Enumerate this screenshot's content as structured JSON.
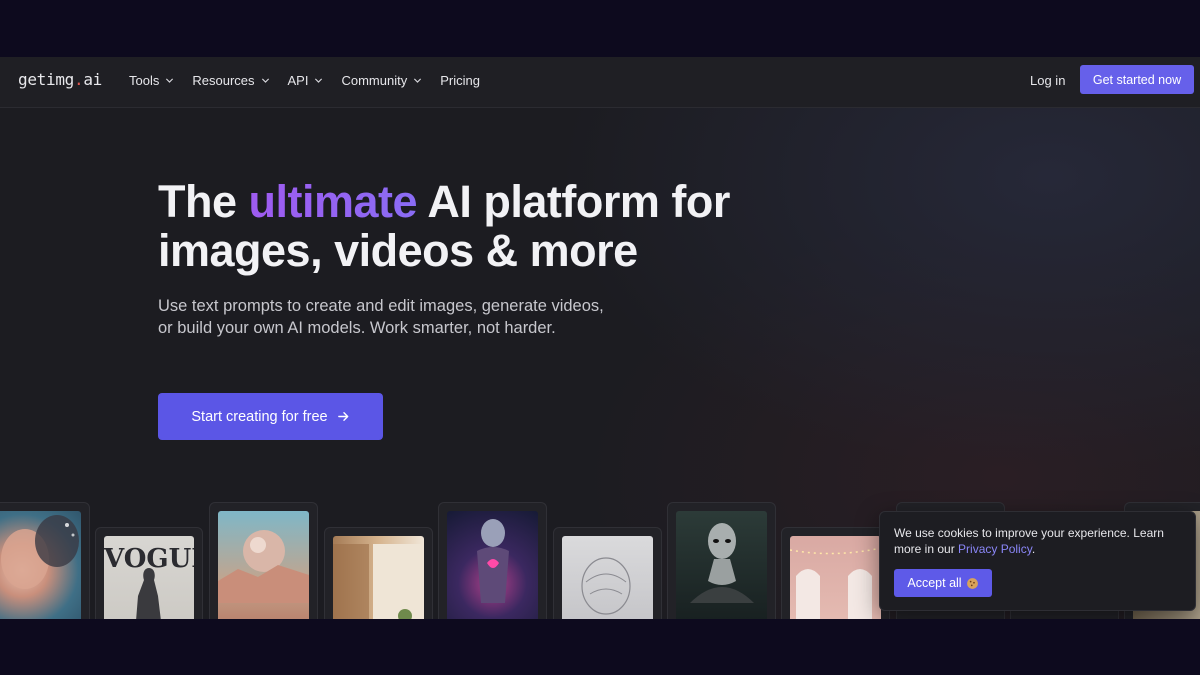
{
  "nav": {
    "logo_prefix": "getimg",
    "logo_dot": ".",
    "logo_suffix": "ai",
    "items": [
      {
        "label": "Tools"
      },
      {
        "label": "Resources"
      },
      {
        "label": "API"
      },
      {
        "label": "Community"
      },
      {
        "label": "Pricing"
      }
    ],
    "login_label": "Log in",
    "cta_label": "Get started now"
  },
  "hero": {
    "title_part1": "The ",
    "title_accent": "ultimate",
    "title_part2": " AI platform for images, videos & more",
    "subtitle": "Use text prompts to create and edit images, generate videos, or build your own AI models. Work smarter, not harder.",
    "cta_label": "Start creating for free",
    "cta_icon": "arrow-right-icon"
  },
  "gallery": {
    "vogue_label": "VOGUE"
  },
  "cookie": {
    "text": "We use cookies to improve your experience. Learn more in our ",
    "link_label": "Privacy Policy",
    "text_end": ".",
    "button_label": "Accept all",
    "button_icon": "cookie-icon"
  },
  "colors": {
    "brand": "#5b56e6",
    "accent_gradient_start": "#9f5bf0",
    "logo_dot": "#e0564f",
    "link": "#8a86f7"
  }
}
